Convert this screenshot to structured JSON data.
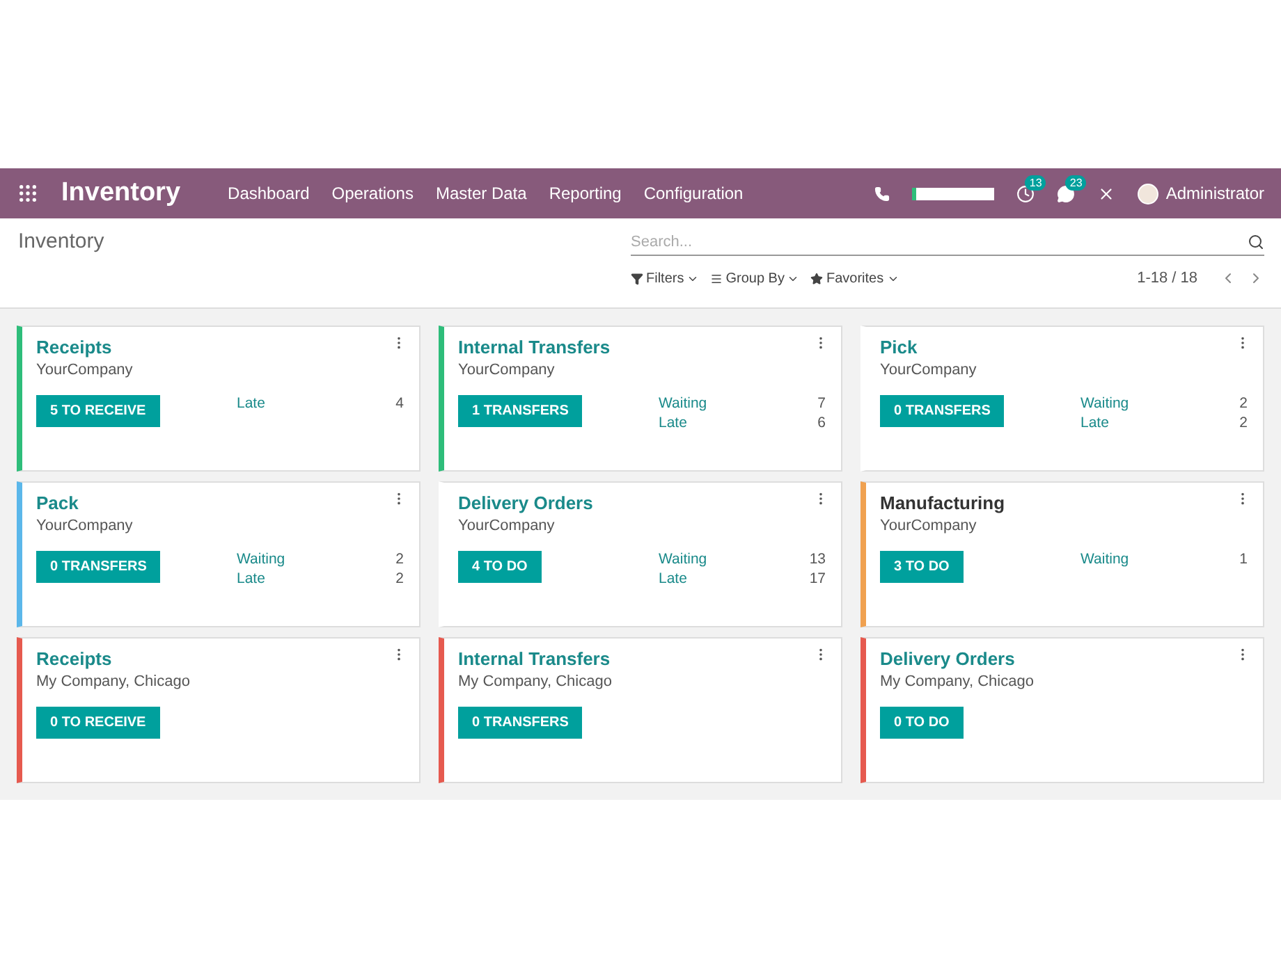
{
  "navbar": {
    "app_title": "Inventory",
    "menu": [
      "Dashboard",
      "Operations",
      "Master Data",
      "Reporting",
      "Configuration"
    ],
    "activity_count": "13",
    "message_count": "23",
    "user": "Administrator"
  },
  "control_panel": {
    "breadcrumb": "Inventory",
    "search": {
      "placeholder": "Search..."
    },
    "filters": [
      "Filters",
      "Group By",
      "Favorites"
    ],
    "pager": "1-18 / 18"
  },
  "cards": [
    {
      "title": "Receipts",
      "title_link": true,
      "company": "YourCompany",
      "color": "#2ebd7a",
      "action": "5 TO RECEIVE",
      "stats": [
        {
          "label": "Late",
          "value": "4"
        }
      ]
    },
    {
      "title": "Internal Transfers",
      "title_link": true,
      "company": "YourCompany",
      "color": "#2ebd7a",
      "action": "1 TRANSFERS",
      "stats": [
        {
          "label": "Waiting",
          "value": "7"
        },
        {
          "label": "Late",
          "value": "6"
        }
      ]
    },
    {
      "title": "Pick",
      "title_link": true,
      "company": "YourCompany",
      "color": "#ffffff",
      "action": "0 TRANSFERS",
      "stats": [
        {
          "label": "Waiting",
          "value": "2"
        },
        {
          "label": "Late",
          "value": "2"
        }
      ]
    },
    {
      "title": "Pack",
      "title_link": true,
      "company": "YourCompany",
      "color": "#5bb7ea",
      "action": "0 TRANSFERS",
      "stats": [
        {
          "label": "Waiting",
          "value": "2"
        },
        {
          "label": "Late",
          "value": "2"
        }
      ]
    },
    {
      "title": "Delivery Orders",
      "title_link": true,
      "company": "YourCompany",
      "color": "#ffffff",
      "action": "4 TO DO",
      "stats": [
        {
          "label": "Waiting",
          "value": "13"
        },
        {
          "label": "Late",
          "value": "17"
        }
      ]
    },
    {
      "title": "Manufacturing",
      "title_link": false,
      "company": "YourCompany",
      "color": "#f0a150",
      "action": "3 TO DO",
      "stats": [
        {
          "label": "Waiting",
          "value": "1"
        }
      ]
    },
    {
      "title": "Receipts",
      "title_link": true,
      "company": "My Company, Chicago",
      "color": "#e65a4f",
      "action": "0 TO RECEIVE"
    },
    {
      "title": "Internal Transfers",
      "title_link": true,
      "company": "My Company, Chicago",
      "color": "#e65a4f",
      "action": "0 TRANSFERS"
    },
    {
      "title": "Delivery Orders",
      "title_link": true,
      "company": "My Company, Chicago",
      "color": "#e65a4f",
      "action": "0 TO DO"
    }
  ]
}
